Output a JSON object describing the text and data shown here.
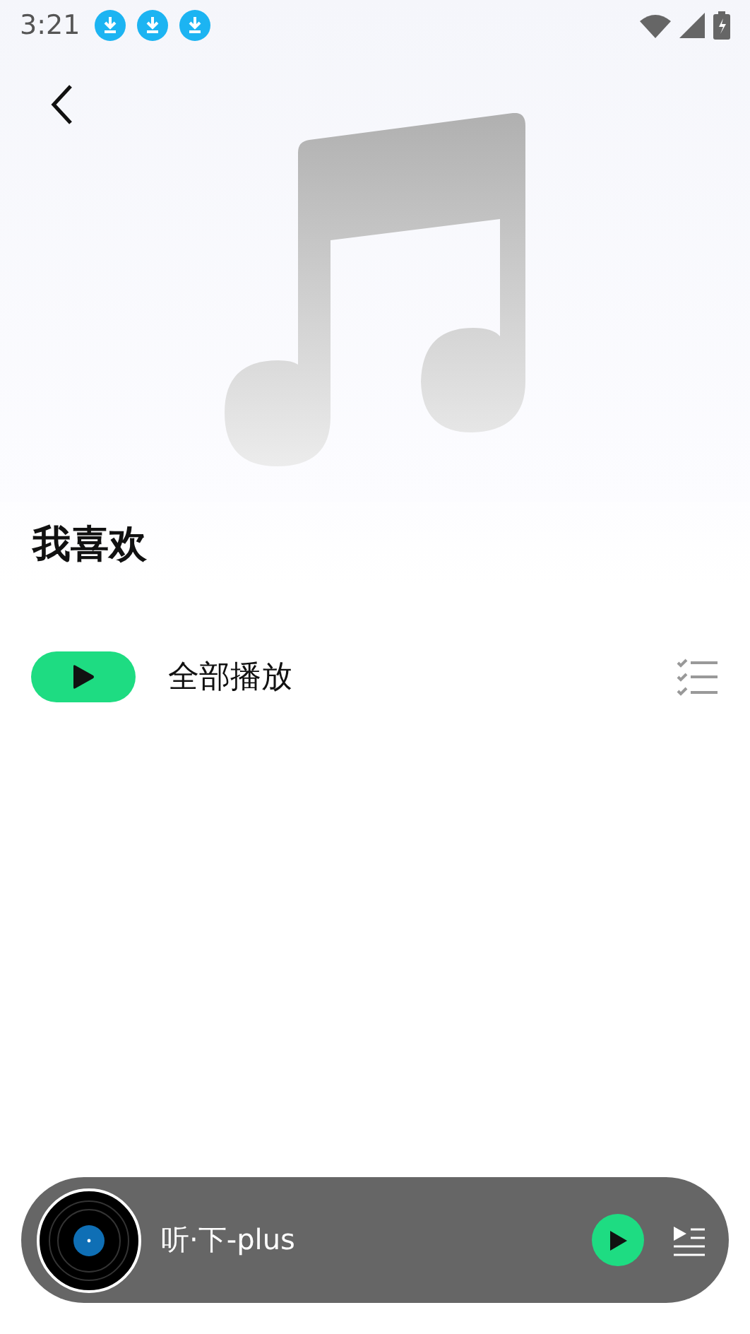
{
  "status_bar": {
    "time": "3:21",
    "notifications": [
      {
        "kind": "download"
      },
      {
        "kind": "download"
      },
      {
        "kind": "download"
      }
    ]
  },
  "playlist": {
    "title": "我喜欢"
  },
  "play_all": {
    "label": "全部播放"
  },
  "mini_player": {
    "track": "听·下-plus"
  }
}
